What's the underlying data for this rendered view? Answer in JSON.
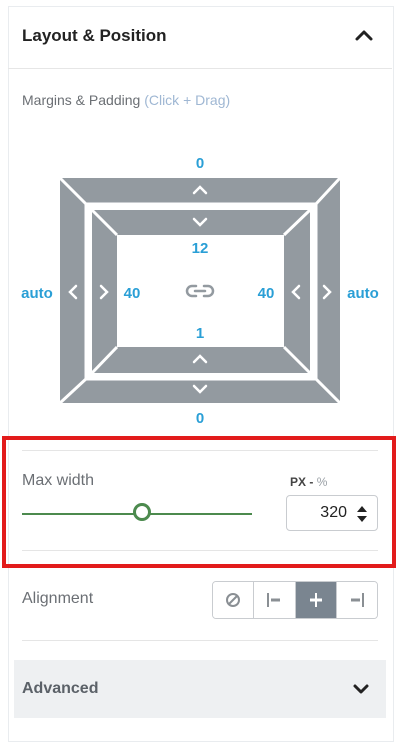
{
  "header": {
    "title": "Layout & Position",
    "chevron_icon": "chevron-up-icon"
  },
  "margins_padding": {
    "label": "Margins & Padding",
    "hint": "(Click + Drag)",
    "margin": {
      "top": "0",
      "bottom": "0",
      "left": "auto",
      "right": "auto"
    },
    "padding": {
      "top": "12",
      "bottom": "1",
      "left": "40",
      "right": "40"
    },
    "link_icon": "link-icon"
  },
  "max_width": {
    "label": "Max width",
    "unit_active": "PX",
    "unit_sep": "-",
    "unit_alt": "%",
    "value": "320",
    "slider_fraction": 0.52
  },
  "alignment": {
    "label": "Alignment",
    "options": [
      "none-icon",
      "align-left-icon",
      "align-center-icon",
      "align-right-icon"
    ],
    "active_index": 2
  },
  "advanced": {
    "title": "Advanced",
    "chevron_icon": "chevron-down-icon"
  },
  "colors": {
    "accent": "#2a9fd6",
    "slider": "#4c8a4e",
    "box": "#939aa0",
    "highlight": "#e21b1b"
  }
}
